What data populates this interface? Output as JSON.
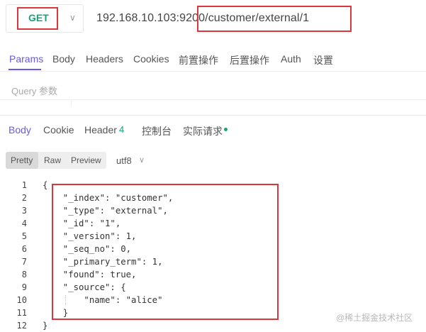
{
  "request": {
    "method": "GET",
    "url": "192.168.10.103:9200/customer/external/1"
  },
  "request_tabs": [
    "Params",
    "Body",
    "Headers",
    "Cookies",
    "前置操作",
    "后置操作",
    "Auth",
    "设置"
  ],
  "query": {
    "label": "Query 参数"
  },
  "response_tabs": {
    "body": "Body",
    "cookie": "Cookie",
    "header": "Header",
    "header_count": "4",
    "console": "控制台",
    "actual_request": "实际请求"
  },
  "format_buttons": [
    "Pretty",
    "Raw",
    "Preview"
  ],
  "encoding": "utf8",
  "line_numbers": [
    "1",
    "2",
    "3",
    "4",
    "5",
    "6",
    "7",
    "8",
    "9",
    "10",
    "11",
    "12"
  ],
  "code_lines": [
    "{",
    "  \"_index\": \"customer\",",
    "  \"_type\": \"external\",",
    "  \"_id\": \"1\",",
    "  \"_version\": 1,",
    "  \"_seq_no\": 0,",
    "  \"_primary_term\": 1,",
    "  \"found\": true,",
    "  \"_source\": {",
    "      \"name\": \"alice\"",
    "  }",
    "}"
  ],
  "watermark": "@稀土掘金技术社区",
  "colors": {
    "accent": "#6a5ae0",
    "method": "#1aa37a",
    "highlight_box": "#d9363e"
  }
}
